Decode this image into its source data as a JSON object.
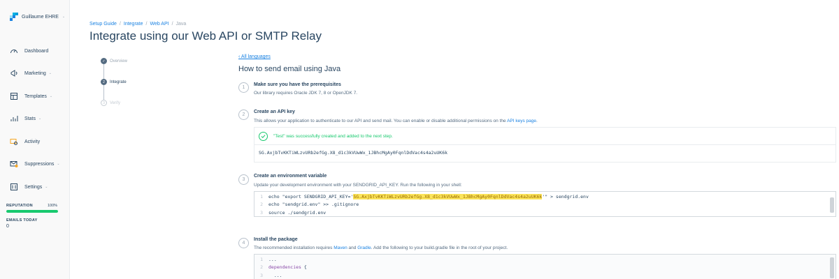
{
  "account": {
    "name": "Guillaume EHRE"
  },
  "sidebar": {
    "items": [
      {
        "label": "Dashboard",
        "icon": "dashboard-icon"
      },
      {
        "label": "Marketing",
        "icon": "marketing-icon"
      },
      {
        "label": "Templates",
        "icon": "templates-icon"
      },
      {
        "label": "Stats",
        "icon": "stats-icon"
      },
      {
        "label": "Activity",
        "icon": "activity-icon"
      },
      {
        "label": "Suppressions",
        "icon": "suppressions-icon"
      },
      {
        "label": "Settings",
        "icon": "settings-icon"
      }
    ],
    "reputation": {
      "label": "REPUTATION",
      "value": "100%",
      "fraction": 1.0
    },
    "emails_today": {
      "label": "EMAILS TODAY",
      "value": "0"
    }
  },
  "breadcrumbs": [
    "Setup Guide",
    "Integrate",
    "Web API",
    "Java"
  ],
  "page_title": "Integrate using our Web API or SMTP Relay",
  "steps_rail": [
    {
      "label": "Overview",
      "state": "done"
    },
    {
      "label": "Integrate",
      "state": "current",
      "number": "2"
    },
    {
      "label": "Verify",
      "state": "upcoming",
      "number": "3"
    }
  ],
  "main": {
    "back_link": "‹ All languages",
    "title": "How to send email using Java",
    "step1": {
      "number": "1",
      "heading": "Make sure you have the prerequisites",
      "text": "Our library requires Oracle JDK 7, 8 or OpenJDK 7."
    },
    "step2": {
      "number": "2",
      "heading": "Create an API key",
      "text": "This allows your application to authenticate to our API and send mail. You can enable or disable additional permissions on the",
      "link": "API keys page",
      "text_end": ".",
      "success": "\"Test\" was successfully created and added to the next step.",
      "api_key": "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"
    },
    "step3": {
      "number": "3",
      "heading": "Create an environment variable",
      "text": "Update your development environment with your SENDGRID_API_KEY. Run the following in your shell:",
      "code": [
        {
          "n": "1",
          "pre": "echo \"export SENDGRID_API_KEY='",
          "key": "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",
          "post": "'\" > sendgrid.env"
        },
        {
          "n": "2",
          "text": "echo \"sendgrid.env\" >> .gitignore"
        },
        {
          "n": "3",
          "text": "source ./sendgrid.env"
        }
      ]
    },
    "step4": {
      "number": "4",
      "heading": "Install the package",
      "text_a": "The recommended installation requires",
      "link_a": "Maven",
      "text_b": "and",
      "link_b": "Gradle",
      "text_c": ". Add the following to your build.gradle file in the root of your project.",
      "code": [
        {
          "n": "1",
          "text": "..."
        },
        {
          "n": "2",
          "kw": "dependencies",
          "text": " {"
        },
        {
          "n": "3",
          "text": "  ..."
        }
      ]
    }
  },
  "colors": {
    "accent": "#1a82e2",
    "success": "#18c96e",
    "text": "#294661",
    "highlight": "#fbe45a"
  }
}
